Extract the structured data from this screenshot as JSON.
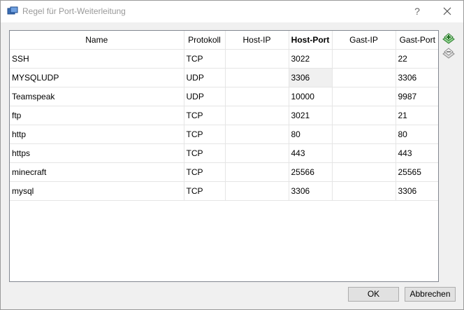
{
  "window": {
    "title": "Regel für Port-Weiterleitung",
    "help_label": "?"
  },
  "table": {
    "columns": [
      "Name",
      "Protokoll",
      "Host-IP",
      "Host-Port",
      "Gast-IP",
      "Gast-Port"
    ],
    "rows": [
      [
        "SSH",
        "TCP",
        "",
        "3022",
        "",
        "22"
      ],
      [
        "MYSQLUDP",
        "UDP",
        "",
        "3306",
        "",
        "3306"
      ],
      [
        "Teamspeak",
        "UDP",
        "",
        "10000",
        "",
        "9987"
      ],
      [
        "ftp",
        "TCP",
        "",
        "3021",
        "",
        "21"
      ],
      [
        "http",
        "TCP",
        "",
        "80",
        "",
        "80"
      ],
      [
        "https",
        "TCP",
        "",
        "443",
        "",
        "443"
      ],
      [
        "minecraft",
        "TCP",
        "",
        "25566",
        "",
        "25565"
      ],
      [
        "mysql",
        "TCP",
        "",
        "3306",
        "",
        "3306"
      ]
    ]
  },
  "side_tools": [
    "add-rule-icon",
    "remove-rule-icon"
  ],
  "buttons": {
    "ok": "OK",
    "cancel": "Abbrechen"
  },
  "colors": {
    "title_text": "#999999",
    "add_icon": "#2e9e2e",
    "remove_icon": "#9a9a9a"
  }
}
